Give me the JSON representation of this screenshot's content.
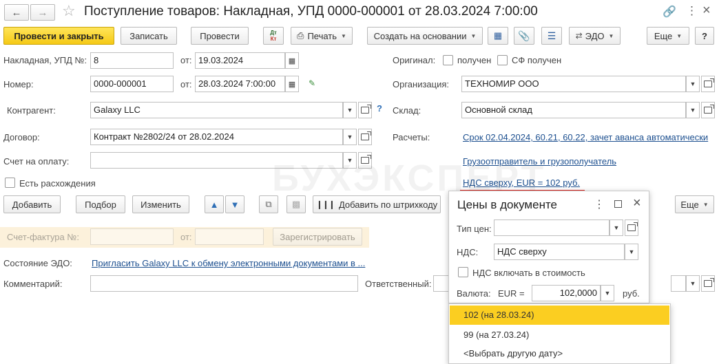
{
  "window": {
    "title": "Поступление товаров: Накладная, УПД 0000-000001 от 28.03.2024 7:00:00"
  },
  "toolbar": {
    "post_close": "Провести и закрыть",
    "save": "Записать",
    "post": "Провести",
    "dtkt_top": "Дт",
    "dtkt_bottom": "Кт",
    "print": "Печать",
    "create_based": "Создать на основании",
    "edo": "ЭДО",
    "more": "Еще",
    "help": "?"
  },
  "form": {
    "invoice_label": "Накладная, УПД №:",
    "invoice_value": "8",
    "from_label": "от:",
    "invoice_date": "19.03.2024",
    "number_label": "Номер:",
    "number_value": "0000-000001",
    "number_date": "28.03.2024  7:00:00",
    "contractor_label": "Контрагент:",
    "contractor_value": "Galaxy LLC",
    "contract_label": "Договор:",
    "contract_value": "Контракт №2802/24 от 28.02.2024",
    "payment_account_label": "Счет на оплату:",
    "discrepancy_label": "Есть расхождения",
    "original_label": "Оригинал:",
    "received_label": "получен",
    "sf_received_label": "СФ получен",
    "org_label": "Организация:",
    "org_value": "ТЕХНОМИР ООО",
    "warehouse_label": "Склад:",
    "warehouse_value": "Основной склад",
    "settlements_label": "Расчеты:",
    "settlements_link": "Срок 02.04.2024, 60.21, 60.22, зачет аванса автоматически",
    "shipper_link": "Грузоотправитель и грузополучатель",
    "vat_link": "НДС сверху, EUR = 102 руб."
  },
  "table_toolbar": {
    "add": "Добавить",
    "pick": "Подбор",
    "change": "Изменить",
    "add_barcode": "Добавить по штрихкоду",
    "more": "Еще"
  },
  "lower": {
    "sf_label": "Счет-фактура №:",
    "sf_from": "от:",
    "register": "Зарегистрировать",
    "edo_state_label": "Состояние ЭДО:",
    "edo_link": "Пригласить Galaxy LLC к обмену электронными документами в ...",
    "comment_label": "Комментарий:",
    "responsible_label": "Ответственный:"
  },
  "watermark": "БУХЭКСПЕРТ",
  "dialog": {
    "title": "Цены в документе",
    "price_type_label": "Тип цен:",
    "vat_label": "НДС:",
    "vat_value": "НДС сверху",
    "vat_include_label": "НДС включать в стоимость",
    "currency_label": "Валюта:",
    "currency_eur": "EUR =",
    "rate_value": "102,0000",
    "rub": "руб."
  },
  "dropdown": {
    "items": [
      "102 (на 28.03.24)",
      "99 (на 27.03.24)",
      "<Выбрать другую дату>"
    ]
  },
  "colors": {
    "primary_button": "#f5c915",
    "link": "#1c4f8f",
    "highlight_underline": "#e0231c",
    "selected_item": "#fbce21"
  }
}
